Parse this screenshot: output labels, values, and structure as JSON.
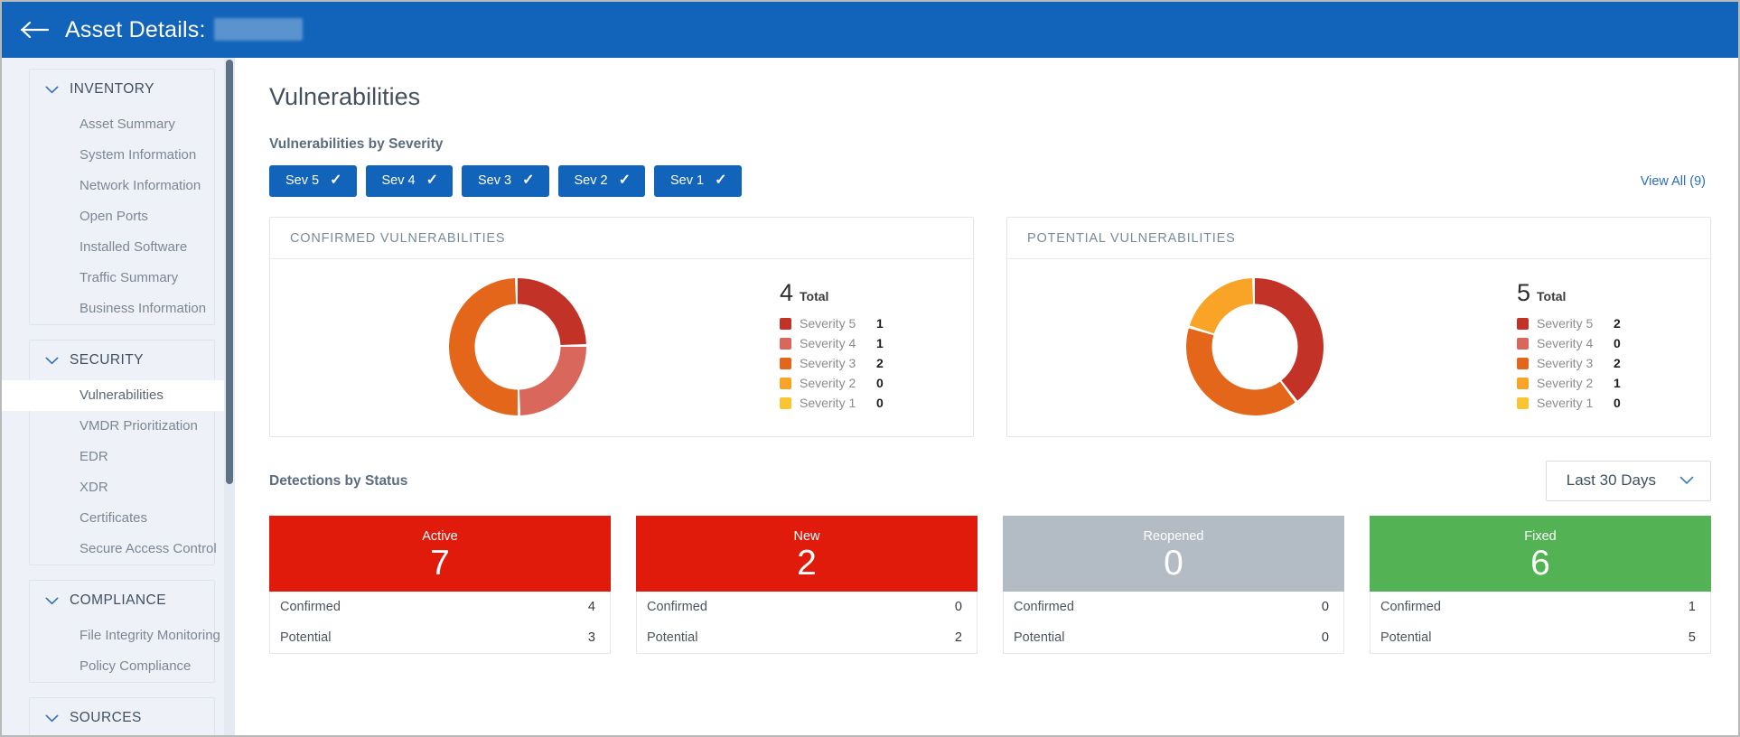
{
  "topbar": {
    "back_icon": "arrow-left-icon",
    "title": "Asset Details:",
    "asset_name_redacted": ""
  },
  "sidebar": {
    "groups": [
      {
        "title": "INVENTORY",
        "items": [
          {
            "label": "Asset Summary",
            "active": false
          },
          {
            "label": "System Information",
            "active": false
          },
          {
            "label": "Network Information",
            "active": false
          },
          {
            "label": "Open Ports",
            "active": false
          },
          {
            "label": "Installed Software",
            "active": false
          },
          {
            "label": "Traffic Summary",
            "active": false
          },
          {
            "label": "Business Information",
            "active": false
          }
        ]
      },
      {
        "title": "SECURITY",
        "items": [
          {
            "label": "Vulnerabilities",
            "active": true
          },
          {
            "label": "VMDR Prioritization",
            "active": false
          },
          {
            "label": "EDR",
            "active": false
          },
          {
            "label": "XDR",
            "active": false
          },
          {
            "label": "Certificates",
            "active": false
          },
          {
            "label": "Secure Access Control",
            "active": false
          }
        ]
      },
      {
        "title": "COMPLIANCE",
        "items": [
          {
            "label": "File Integrity Monitoring",
            "active": false
          },
          {
            "label": "Policy Compliance",
            "active": false
          }
        ]
      },
      {
        "title": "SOURCES",
        "items": []
      }
    ]
  },
  "main": {
    "page_title": "Vulnerabilities",
    "severity_section_label": "Vulnerabilities by Severity",
    "severity_chips": [
      {
        "label": "Sev 5",
        "checked": true
      },
      {
        "label": "Sev 4",
        "checked": true
      },
      {
        "label": "Sev 3",
        "checked": true
      },
      {
        "label": "Sev 2",
        "checked": true
      },
      {
        "label": "Sev 1",
        "checked": true
      }
    ],
    "view_all": "View All (9)",
    "detections_label": "Detections by Status",
    "time_filter": "Last 30 Days",
    "total_label": "Total"
  },
  "colors": {
    "brand_blue": "#1263ba",
    "severity_5": "#c33227",
    "severity_4": "#d9675c",
    "severity_3": "#e3661b",
    "severity_2": "#f9a327",
    "severity_1": "#fbc431",
    "status_active": "#e01b0c",
    "status_new": "#e01b0c",
    "status_reopened": "#b3bcc4",
    "status_fixed": "#53b254"
  },
  "chart_data": [
    {
      "type": "pie",
      "title": "CONFIRMED VULNERABILITIES",
      "total": 4,
      "categories": [
        "Severity 5",
        "Severity 4",
        "Severity 3",
        "Severity 2",
        "Severity 1"
      ],
      "values": [
        1,
        1,
        2,
        0,
        0
      ],
      "colors": [
        "#c33227",
        "#d9675c",
        "#e3661b",
        "#f9a327",
        "#fbc431"
      ],
      "legend": "right",
      "donut": true
    },
    {
      "type": "pie",
      "title": "POTENTIAL VULNERABILITIES",
      "total": 5,
      "categories": [
        "Severity 5",
        "Severity 4",
        "Severity 3",
        "Severity 2",
        "Severity 1"
      ],
      "values": [
        2,
        0,
        2,
        1,
        0
      ],
      "colors": [
        "#c33227",
        "#d9675c",
        "#e3661b",
        "#f9a327",
        "#fbc431"
      ],
      "legend": "right",
      "donut": true
    }
  ],
  "detections": {
    "row_labels": {
      "confirmed": "Confirmed",
      "potential": "Potential"
    },
    "cards": [
      {
        "status": "Active",
        "total": "7",
        "confirmed": "4",
        "potential": "3",
        "color": "#e01b0c"
      },
      {
        "status": "New",
        "total": "2",
        "confirmed": "0",
        "potential": "2",
        "color": "#e01b0c"
      },
      {
        "status": "Reopened",
        "total": "0",
        "confirmed": "0",
        "potential": "0",
        "color": "#b3bcc4"
      },
      {
        "status": "Fixed",
        "total": "6",
        "confirmed": "1",
        "potential": "5",
        "color": "#53b254"
      }
    ]
  }
}
